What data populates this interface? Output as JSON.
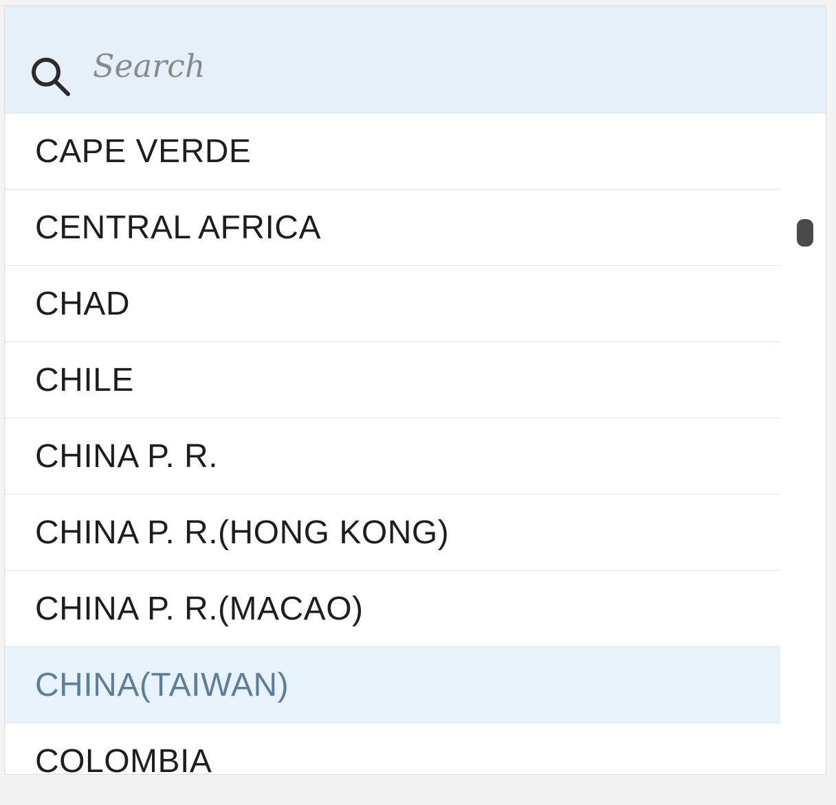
{
  "search": {
    "placeholder": "Search",
    "value": ""
  },
  "options": [
    {
      "label": "CAPE VERDE"
    },
    {
      "label": "CENTRAL AFRICA"
    },
    {
      "label": "CHAD"
    },
    {
      "label": "CHILE"
    },
    {
      "label": "CHINA P. R."
    },
    {
      "label": "CHINA P. R.(HONG KONG)"
    },
    {
      "label": "CHINA P. R.(MACAO)"
    },
    {
      "label": "CHINA(TAIWAN)"
    },
    {
      "label": "COLOMBIA"
    }
  ],
  "hovered_option": "CHINA(TAIWAN)",
  "icons": {
    "search": "search-icon"
  },
  "colors": {
    "search_bg": "#e6f0f8",
    "hover_bg": "#e8f2fb",
    "hover_text": "#5b7f9b",
    "text": "#1e1e1e"
  }
}
